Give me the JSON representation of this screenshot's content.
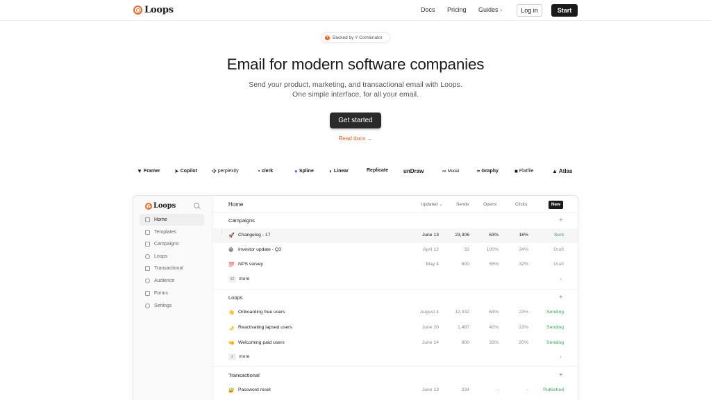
{
  "nav": {
    "brand": "Loops",
    "links": [
      "Docs",
      "Pricing",
      "Guides"
    ],
    "guides_chevron": "›",
    "login": "Log in",
    "start": "Start"
  },
  "hero": {
    "badge": "Backed by Y Combinator",
    "badge_icon": "Y",
    "title": "Email for modern software companies",
    "sub1": "Send your product, marketing, and transactional email with Loops.",
    "sub2": "One simple interface, for all your email.",
    "cta": "Get started",
    "docs": "Read docs →"
  },
  "logos": [
    "Framer",
    "Copilot",
    "perplexity",
    "clerk",
    "Spline",
    "Linear",
    "Replicate",
    "unDraw",
    "Modal",
    "Graphy",
    "Flatfile",
    "Atlas"
  ],
  "app": {
    "brand": "Loops",
    "sidebar": [
      "Home",
      "Templates",
      "Campaigns",
      "Loops",
      "Transactional",
      "Audience",
      "Forms",
      "Settings"
    ],
    "header": {
      "title": "Home",
      "sort": "Updated",
      "cols": [
        "Sends",
        "Opens",
        "Clicks"
      ],
      "new": "New"
    },
    "campaigns": {
      "title": "Campaigns",
      "rows": [
        {
          "emoji": "🚀",
          "name": "Changelog - 17",
          "date": "June 13",
          "sends": "23,306",
          "opens": "63%",
          "clicks": "16%",
          "status": "Sent"
        },
        {
          "emoji": "😁",
          "name": "Investor update - Q3",
          "date": "April 12",
          "sends": "32",
          "opens": "100%",
          "clicks": "24%",
          "status": "Draft"
        },
        {
          "emoji": "💯",
          "name": "NPS survey",
          "date": "May 4",
          "sends": "600",
          "opens": "55%",
          "clicks": "32%",
          "status": "Draft"
        }
      ],
      "more_count": "12",
      "more": "more"
    },
    "loops": {
      "title": "Loops",
      "rows": [
        {
          "emoji": "👋",
          "name": "Onboarding free users",
          "date": "August 4",
          "sends": "12,332",
          "opens": "64%",
          "clicks": "23%",
          "status": "Sending"
        },
        {
          "emoji": "🌛",
          "name": "Reactivating lapsed users",
          "date": "June 20",
          "sends": "1,487",
          "opens": "42%",
          "clicks": "22%",
          "status": "Sending"
        },
        {
          "emoji": "🤜",
          "name": "Welcoming paid users",
          "date": "June 14",
          "sends": "800",
          "opens": "33%",
          "clicks": "20%",
          "status": "Sending"
        }
      ],
      "more_count": "2",
      "more": "more"
    },
    "transactional": {
      "title": "Transactional",
      "rows": [
        {
          "emoji": "🔐",
          "name": "Password reset",
          "date": "June 13",
          "sends": "234",
          "opens": "-",
          "clicks": "-",
          "status": "Published"
        }
      ]
    }
  },
  "colors": {
    "accent": "#e9682d",
    "green": "#3aa55d",
    "dark": "#1a1a1a"
  }
}
